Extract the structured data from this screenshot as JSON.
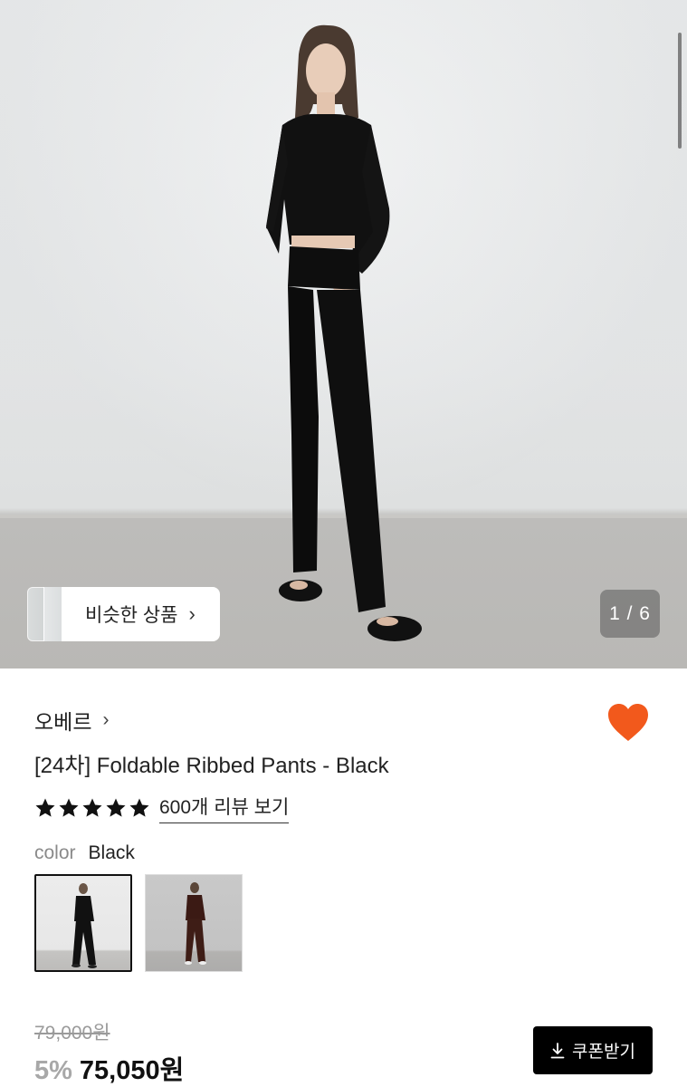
{
  "gallery": {
    "counter": "1 / 6",
    "similar_label": "비슷한 상품",
    "similar_chevron": "›"
  },
  "product": {
    "brand": "오베르",
    "brand_chevron": "›",
    "title": "[24차] Foldable Ribbed Pants - Black",
    "rating_stars": 5,
    "review_link": "600개 리뷰 보기",
    "wishlisted": true,
    "heart_color": "#f2591c"
  },
  "options": {
    "color_label": "color",
    "color_value": "Black",
    "swatches": [
      {
        "name": "Black",
        "selected": true
      },
      {
        "name": "Brown",
        "selected": false
      }
    ]
  },
  "pricing": {
    "original_price": "79,000원",
    "discount": "5%",
    "price": "75,050원",
    "coupon_label": "쿠폰받기"
  }
}
